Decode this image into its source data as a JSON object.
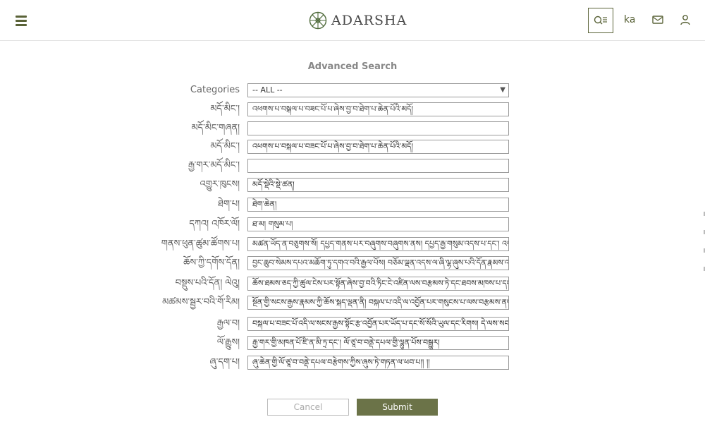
{
  "brand": {
    "name": "ADARSHA",
    "accent": "#5a6338"
  },
  "header": {
    "lang_label": "ka"
  },
  "page": {
    "title": "Advanced Search"
  },
  "form": {
    "category_label": "Categories",
    "category_value": "-- ALL --",
    "fields": [
      {
        "label": "མདོ་མིང་།",
        "value": "འཕགས་པ་བསྐལ་པ་བཟང་པོ་པ་ཞེས་བྱ་བ་ཐེག་པ་ཆེན་པོའི་མདོ།"
      },
      {
        "label": "མདོ་མིང་གཞན།",
        "value": ""
      },
      {
        "label": "མདོ་མིང་།",
        "value": "འཕགས་པ་བསྐལ་པ་བཟང་པོ་པ་ཞེས་བྱ་བ་ཐེག་པ་ཆེན་པོའི་མདོ།"
      },
      {
        "label": "རྒྱ་གར་མདོ་མིང་།",
        "value": ""
      },
      {
        "label": "འགྱུར་ཁུངས།",
        "value": "མདོ་སྡེའི་སྡེ་ཚན།"
      },
      {
        "label": "ཐེག་པ།",
        "value": "ཐེག་ཆེན།"
      },
      {
        "label": "དཀའ། འཁོར་ལོ།",
        "value": "ཐ་མ། གསུམ་པ།"
      },
      {
        "label": "གནས་ཕུན་ཚུམ་ཚོགས་པ།",
        "value": "མཚན་ཡོད་ན་བཅུགས་སོ། དཔྱད་གནས་པར་བཞུགས་བཞུགས་ནས། དཔྱད་རྒྱ་གསུམ་འདས་པ་དང་། འཕགས་པ་ཟླ་སྦྱིན་ཞིང་"
      },
      {
        "label": "ཆོས་ཀྱི་དགོས་དོན།",
        "value": "བྱང་ཆུབ་སེམས་དཔའ་མཆོག་ཏུ་དགའ་བའི་རྒྱལ་པོས། བཅོམ་ལྡན་འདས་ལ་ཞི་ལྷ་ཞུས་པའི་དོན་རྣམས་འཆད་ཅིང་ཡོ་རྣམས་"
      },
      {
        "label": "བསྡུས་པའི་དོན། ལེའུ།",
        "value": "ཆོས་ཐམས་ཅད་ཀྱི་ཚུལ་ངེས་པར་སྟོན་ཞེས་བྱ་བའི་ཏིང་ངེ་འཛིན་ལས་བརྩམས་ཏེ་དང་ཐབས་མཁས་པ་དང་། ཡོངས་སུ་སྦྱོང་བར་བྱེད་པའི་"
      },
      {
        "label": "མཚམས་སྦྱར་བའི་གོ་རིམ།",
        "value": "སྔོན་གྱི་སངས་རྒྱས་རྣམས་ཀྱི་ཆོས་སྐད་ལྡན་ནི། བསྐལ་པ་འདི་ལ་འབྱོན་པར་གསུངས་པ་ལས་བརྩམས་ནས་རྒྱ་ཆེར་གསུངས་ཏེ། ཡུམ་ཆོས་ཐམས་ཅད་ཀྱི་ཚོ"
      },
      {
        "label": "རྒྱལ་བ།",
        "value": "བསྐལ་པ་བཟང་པོ་འདི་ལ་སངས་རྒྱས་སྟོང་རྩ་འབྱོན་པར་ཡོད་པ་དང་སོ་སོའི་ཡུལ་དང་རིགས། དེ་ལས་སངས་རྒྱས་བསྟན་ནོ།"
      },
      {
        "label": "ལོ་རྒྱུས།",
        "value": "རྒྱ་གར་གྱི་མཁན་པོ་ཛི་ན་མི་ཏྲ་དང་། ལོ་ཙཱ་བ་བནྡེ་དཔལ་གྱི་ལྷུན་པོས་བསྒྱུར།"
      },
      {
        "label": "ཞུ་དག་པ།",
        "value": "ཞུ་ཆེན་གྱི་ལོ་ཙཱ་བ་བནྡེ་དཔལ་བརྩེགས་ཀྱིས་ཞུས་ཏེ་གཏན་ལ་ཕབ་པ།། །།"
      }
    ]
  },
  "actions": {
    "cancel_label": "Cancel",
    "submit_label": "Submit"
  }
}
